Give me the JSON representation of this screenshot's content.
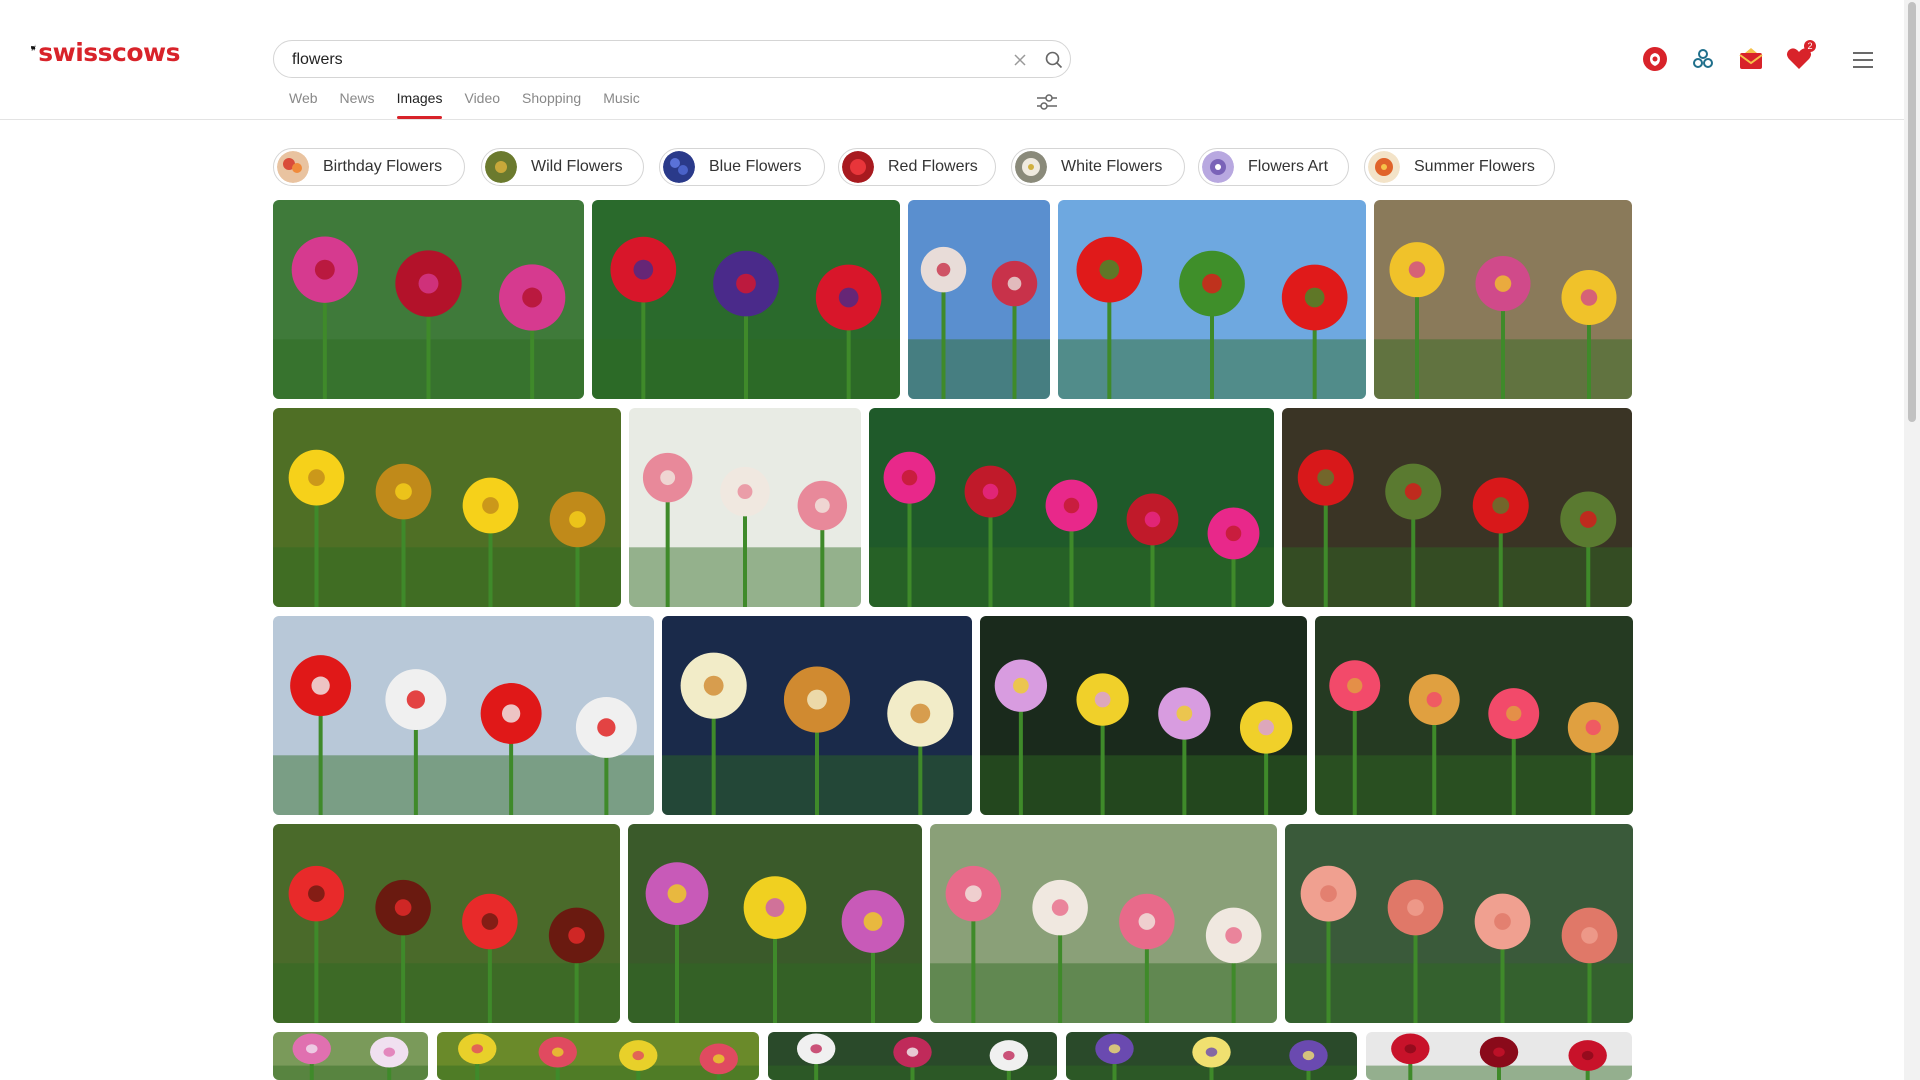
{
  "brand": {
    "name": "swisscows",
    "color": "#d8232a"
  },
  "search": {
    "query": "flowers",
    "placeholder": ""
  },
  "tabs": [
    {
      "label": "Web",
      "active": false
    },
    {
      "label": "News",
      "active": false
    },
    {
      "label": "Images",
      "active": true
    },
    {
      "label": "Video",
      "active": false
    },
    {
      "label": "Shopping",
      "active": false
    },
    {
      "label": "Music",
      "active": false
    }
  ],
  "header_icons": [
    "vpn-shield-icon",
    "teleguard-icon",
    "mail-icon",
    "heart-icon"
  ],
  "notification_count": "2",
  "chips": [
    {
      "label": "Birthday Flowers",
      "color": "#d94c3a"
    },
    {
      "label": "Wild Flowers",
      "color": "#6b7a2e"
    },
    {
      "label": "Blue Flowers",
      "color": "#3a4fb0"
    },
    {
      "label": "Red Flowers",
      "color": "#c8252b"
    },
    {
      "label": "White Flowers",
      "color": "#d9d3c3"
    },
    {
      "label": "Flowers Art",
      "color": "#7a63b8"
    },
    {
      "label": "Summer Flowers",
      "color": "#e0632a"
    }
  ],
  "images": [
    {
      "alt": "pink and red roses",
      "bg": "#3f7a3a",
      "flower": "#d63a8f",
      "accent": "#b3122a"
    },
    {
      "alt": "red tulips purple flowers",
      "bg": "#2a6a2c",
      "flower": "#d8162a",
      "accent": "#4a2a8a"
    },
    {
      "alt": "white red tulips",
      "bg": "#5a8fcf",
      "flower": "#e8dcd8",
      "accent": "#c8324a"
    },
    {
      "alt": "red tulips sky",
      "bg": "#6ea8e0",
      "flower": "#e01a1a",
      "accent": "#3f8f2a"
    },
    {
      "alt": "tulips sunset",
      "bg": "#8a7a5a",
      "flower": "#f0c22a",
      "accent": "#d04a8a"
    },
    {
      "alt": "yellow flower",
      "bg": "#4f6f25",
      "flower": "#f6d11a",
      "accent": "#c08a1a"
    },
    {
      "alt": "rose bouquet vase",
      "bg": "#e8ebe4",
      "flower": "#e8899a",
      "accent": "#f0e8e0"
    },
    {
      "alt": "pink roses",
      "bg": "#1f5a2a",
      "flower": "#e8288a",
      "accent": "#c01a2a"
    },
    {
      "alt": "red hibiscus",
      "bg": "#3a3425",
      "flower": "#d8181a",
      "accent": "#5a7a30"
    },
    {
      "alt": "red tulips field",
      "bg": "#b8c8d8",
      "flower": "#e01818",
      "accent": "#f0f0f0"
    },
    {
      "alt": "white lily",
      "bg": "#1a2a4a",
      "flower": "#f2ecc8",
      "accent": "#d08a30"
    },
    {
      "alt": "pink dahlia",
      "bg": "#1a2a1c",
      "flower": "#d89ce0",
      "accent": "#f0d02a"
    },
    {
      "alt": "pink hibiscus",
      "bg": "#253a22",
      "flower": "#f24a6a",
      "accent": "#e0a040"
    },
    {
      "alt": "red lily",
      "bg": "#4a6a2a",
      "flower": "#e82a2a",
      "accent": "#6a1a10"
    },
    {
      "alt": "mixed spring flowers",
      "bg": "#3a5a2a",
      "flower": "#c85ab8",
      "accent": "#f0d020"
    },
    {
      "alt": "strawflowers",
      "bg": "#8aa078",
      "flower": "#e86a8a",
      "accent": "#f0e8e0"
    },
    {
      "alt": "pink roses bush",
      "bg": "#3a5a3a",
      "flower": "#f0a090",
      "accent": "#e07868"
    },
    {
      "alt": "pink lilies",
      "bg": "#7a9a5a",
      "flower": "#e070b0",
      "accent": "#f0e0f0"
    },
    {
      "alt": "gerbera",
      "bg": "#6a8a2a",
      "flower": "#e8d02a",
      "accent": "#e04a60"
    },
    {
      "alt": "white pink flowers",
      "bg": "#2a4a2a",
      "flower": "#f0f0f0",
      "accent": "#c02a5a"
    },
    {
      "alt": "passion flower",
      "bg": "#2a4a2a",
      "flower": "#6a4ab0",
      "accent": "#f0e070"
    },
    {
      "alt": "red rose",
      "bg": "#e8e8e8",
      "flower": "#c8122a",
      "accent": "#8a0a1a"
    }
  ]
}
